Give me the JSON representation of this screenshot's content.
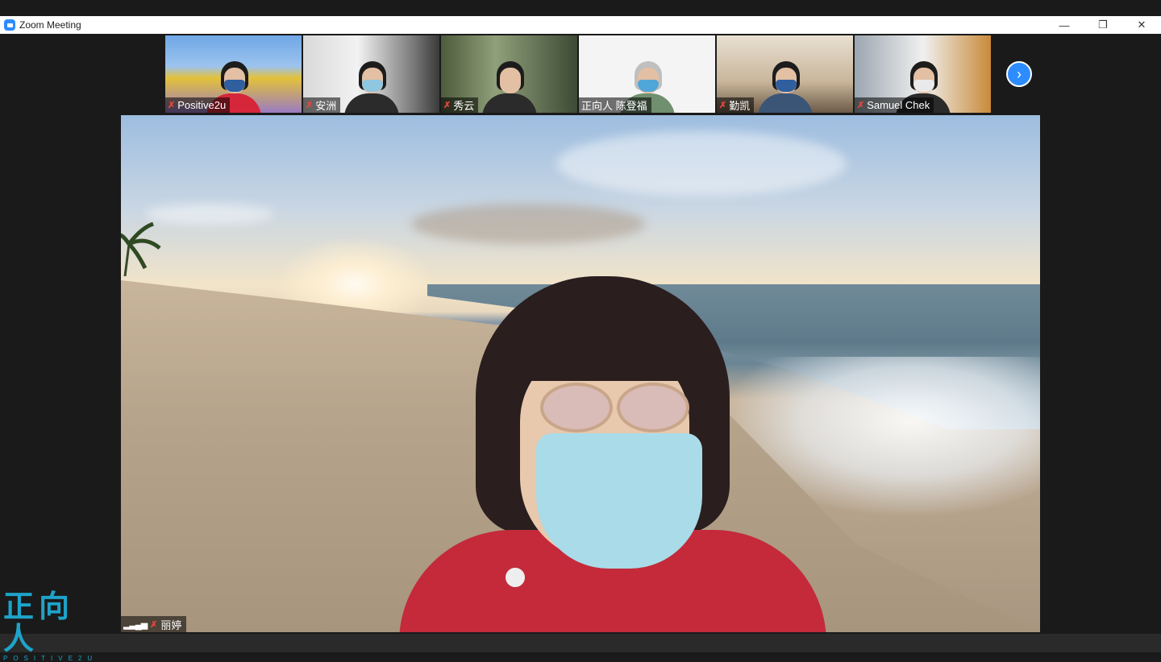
{
  "window": {
    "title": "Zoom Meeting",
    "controls": [
      "—",
      "❐",
      "✕"
    ]
  },
  "gallery": {
    "participants": [
      {
        "name": "Positive2u"
      },
      {
        "name": "安洲"
      },
      {
        "name": "秀云"
      },
      {
        "name": "正向人 陈登福"
      },
      {
        "name": "勤凯"
      },
      {
        "name": "Samuel Chek"
      }
    ],
    "next_icon": "chevron-right-icon"
  },
  "active_speaker": {
    "name": "丽婷"
  },
  "watermark": {
    "cn": "正向人",
    "en": "POSITIVE2U"
  },
  "colors": {
    "accent": "#2d8cff",
    "mic_off": "#e5463e",
    "logo": "#1ea3c9"
  }
}
